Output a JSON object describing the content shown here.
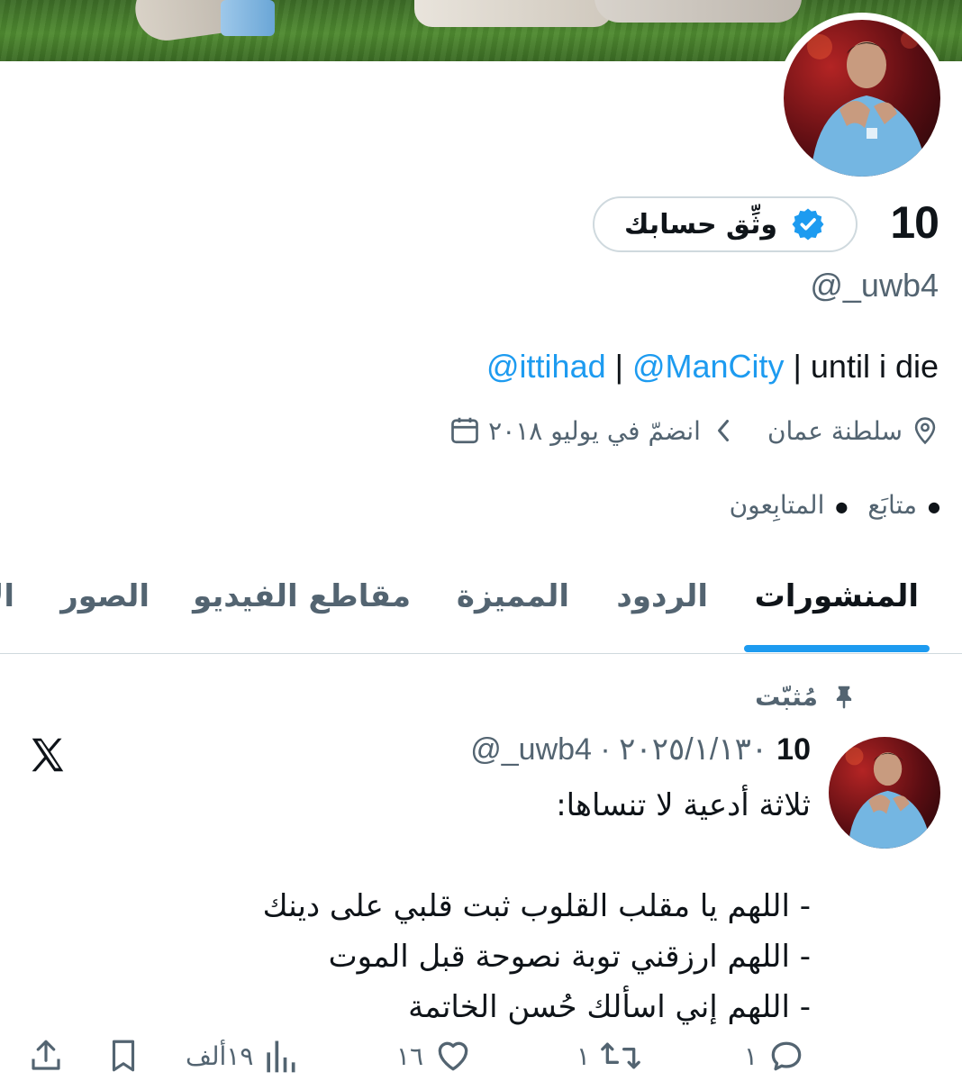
{
  "profile": {
    "display_name": "10",
    "verify_label": "وثِّق حسابك",
    "handle": "@_uwb4",
    "bio": {
      "mention1": "@ittihad",
      "sep1": " | ",
      "mention2": "@ManCity",
      "sep2": " | ",
      "text": "until i die"
    },
    "location": "سلطنة عمان",
    "joined": "انضمّ في يوليو ٢٠١٨",
    "following_label": "متابَع",
    "followers_label": "المتابِعون"
  },
  "tabs": [
    {
      "label": "المنشورات",
      "active": true
    },
    {
      "label": "الردود"
    },
    {
      "label": "المميزة"
    },
    {
      "label": "مقاطع الفيديو"
    },
    {
      "label": "الصور"
    },
    {
      "label": "الإ"
    }
  ],
  "pinned_label": "مُثبّت",
  "tweet": {
    "name": "10",
    "meta": "@_uwb4 · ٢٠٢٥/١/١٣٠",
    "lines": [
      "ثلاثة أدعية لا تنساها:",
      "",
      "- اللهم يا مقلب القلوب ثبت قلبي على دينك",
      "- اللهم ارزقني توبة نصوحة قبل الموت",
      "- اللهم إني اسألك حُسن الخاتمة"
    ],
    "actions": {
      "replies": "١",
      "reposts": "١",
      "likes": "١٦",
      "views": "١٩ألف"
    }
  },
  "icons": {
    "verified": "verified-badge-icon",
    "location": "location-pin-icon",
    "calendar": "calendar-icon",
    "pin": "pin-icon",
    "x_logo": "x-logo-icon"
  },
  "colors": {
    "accent": "#1d9bf0",
    "secondary_text": "#536471",
    "primary_text": "#0f1419"
  }
}
